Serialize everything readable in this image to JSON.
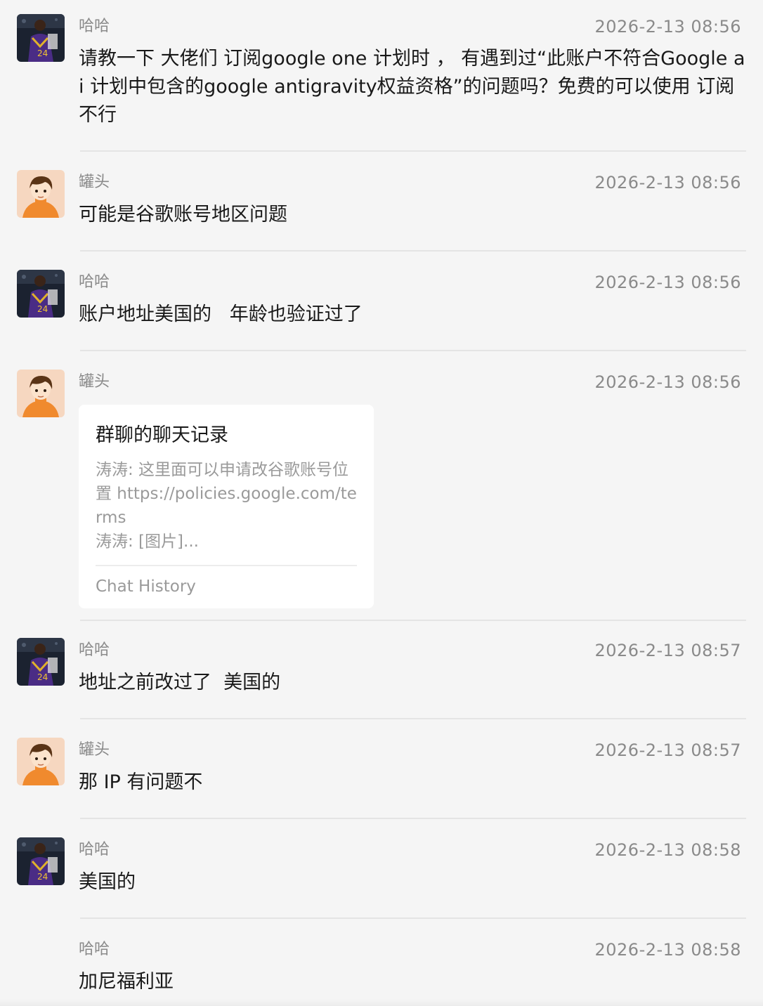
{
  "messages": [
    {
      "sender": "哈哈",
      "avatar": "kobe-jersey-avatar",
      "time": "2026-2-13 08:56",
      "text": "请教一下 大佬们 订阅google one 计划时 ， 有遇到过“此账户不符合Google ai 计划中包含的google antigravity权益资格”的问题吗？免费的可以使用 订阅不行"
    },
    {
      "sender": "罐头",
      "avatar": "cartoon-boy-avatar",
      "time": "2026-2-13 08:56",
      "text": "可能是谷歌账号地区问题"
    },
    {
      "sender": "哈哈",
      "avatar": "kobe-jersey-avatar",
      "time": "2026-2-13 08:56",
      "text": "账户地址美国的   年龄也验证过了"
    },
    {
      "sender": "罐头",
      "avatar": "cartoon-boy-avatar",
      "time": "2026-2-13 08:56",
      "card": {
        "title": "群聊的聊天记录",
        "lines": [
          "涛涛: 这里面可以申请改谷歌账号位置 https://policies.google.com/terms",
          "涛涛: [图片]..."
        ],
        "footer": "Chat History"
      }
    },
    {
      "sender": "哈哈",
      "avatar": "kobe-jersey-avatar",
      "time": "2026-2-13 08:57",
      "text": "地址之前改过了  美国的"
    },
    {
      "sender": "罐头",
      "avatar": "cartoon-boy-avatar",
      "time": "2026-2-13 08:57",
      "text": "那 IP 有问题不"
    },
    {
      "sender": "哈哈",
      "avatar": "kobe-jersey-avatar",
      "time": "2026-2-13 08:58",
      "text": "美国的"
    },
    {
      "sender": "哈哈",
      "time": "2026-2-13 08:58",
      "text": "加尼福利亚"
    }
  ]
}
